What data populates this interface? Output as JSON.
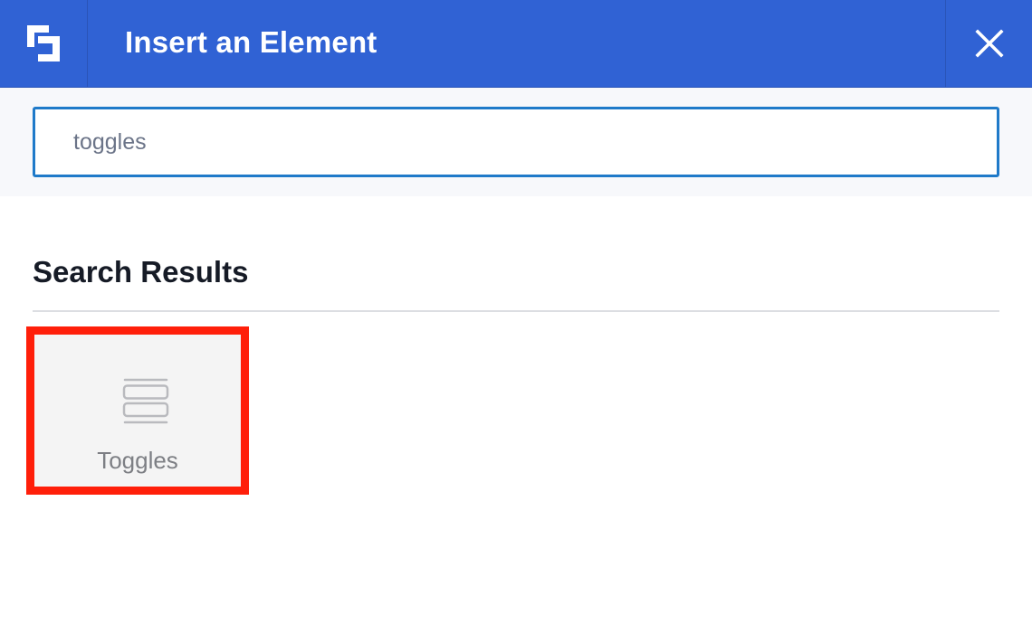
{
  "header": {
    "title": "Insert an Element",
    "logo_icon": "builder-logo-icon",
    "close_icon": "close-icon",
    "background_color": "#3062d4"
  },
  "search": {
    "value": "toggles",
    "border_color": "#1f7ac9"
  },
  "results": {
    "heading": "Search Results",
    "items": [
      {
        "label": "Toggles",
        "icon": "toggles-icon",
        "highlight_color": "#ff1f0a"
      }
    ]
  }
}
